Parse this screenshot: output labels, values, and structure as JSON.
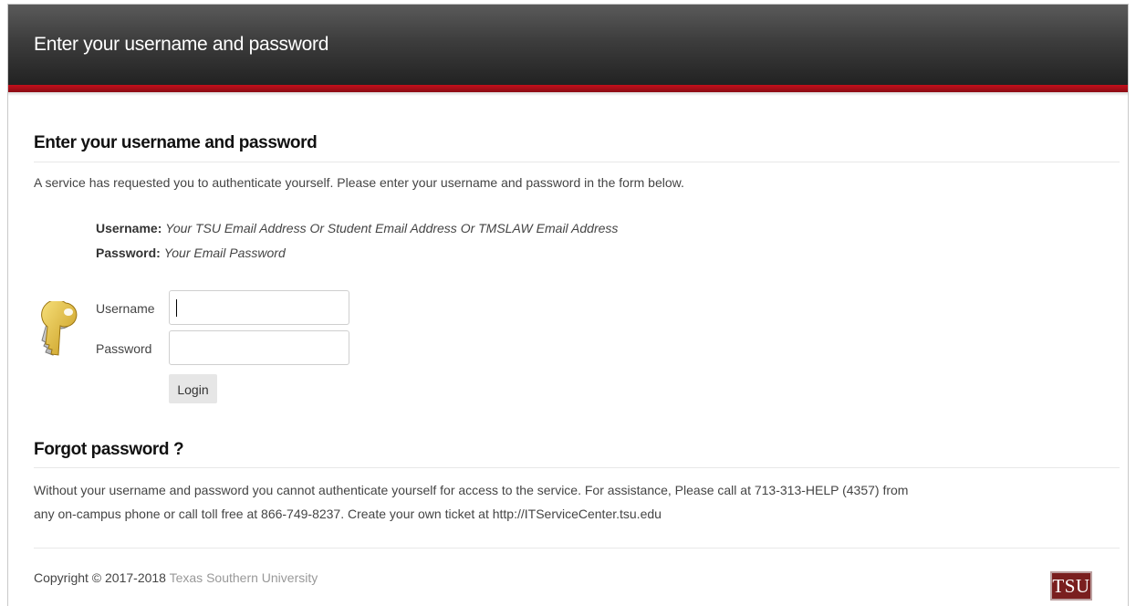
{
  "header": {
    "title": "Enter your username and password"
  },
  "login_section": {
    "heading": "Enter your username and password",
    "intro": "A service has requested you to authenticate yourself. Please enter your username and password in the form below.",
    "hints": {
      "username_label": "Username:",
      "username_text": "Your TSU Email Address Or Student Email Address Or TMSLAW Email Address",
      "password_label": "Password:",
      "password_text": "Your Email Password"
    },
    "form": {
      "username_label": "Username",
      "username_value": "",
      "password_label": "Password",
      "password_value": "",
      "login_button": "Login"
    }
  },
  "forgot_section": {
    "heading": "Forgot password ?",
    "line1": "Without your username and password you cannot authenticate yourself for access to the service. For assistance, Please call at 713-313-HELP (4357) from",
    "line2": "any on-campus phone or call toll free at 866-749-8237. Create your own ticket at http://ITServiceCenter.tsu.edu"
  },
  "footer": {
    "copyright": "Copyright © 2017-2018",
    "university": "Texas Southern University",
    "logo_text": "TSU"
  },
  "colors": {
    "header_dark": "#2b2b2b",
    "accent_red": "#b40f1a",
    "logo_maroon": "#7a1f1f"
  },
  "icons": {
    "login_icon": "keys-icon"
  }
}
